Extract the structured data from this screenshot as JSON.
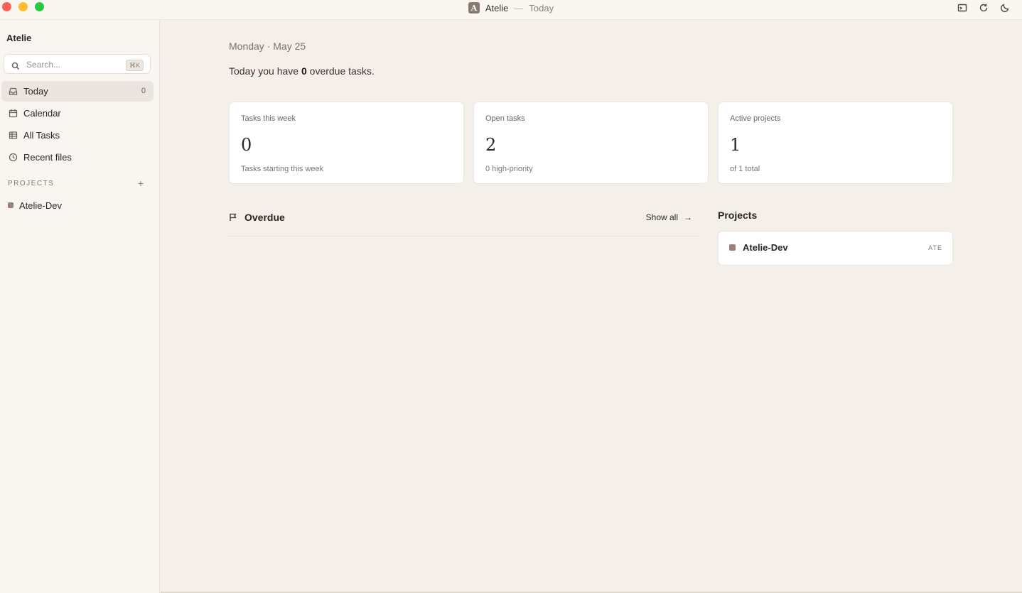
{
  "window": {
    "app_name": "Atelie",
    "separator": "—",
    "page": "Today",
    "app_badge_letter": "A",
    "actions": [
      "terminal-icon",
      "refresh-icon",
      "moon-icon"
    ]
  },
  "sidebar": {
    "workspace": "Atelie",
    "search": {
      "placeholder": "Search...",
      "shortcut": "⌘K"
    },
    "nav": [
      {
        "label": "Today",
        "icon": "inbox-icon",
        "count": "0",
        "active": true
      },
      {
        "label": "Calendar",
        "icon": "calendar-icon"
      },
      {
        "label": "All Tasks",
        "icon": "table-icon"
      },
      {
        "label": "Recent files",
        "icon": "clock-icon"
      }
    ],
    "projects_header": "PROJECTS",
    "add_label": "+",
    "projects": [
      {
        "label": "Atelie-Dev",
        "color": "#9b7f78"
      }
    ]
  },
  "main": {
    "date": "Monday · May 25",
    "summary": {
      "prefix": "Today you have",
      "count": "0",
      "suffix": "overdue tasks."
    },
    "cards": [
      {
        "label": "Tasks this week",
        "value": "0",
        "sub": "Tasks starting this week"
      },
      {
        "label": "Open tasks",
        "value": "2",
        "sub": "0 high-priority"
      },
      {
        "label": "Active projects",
        "value": "1",
        "sub": "of 1 total"
      }
    ],
    "overdue": {
      "title": "Overdue",
      "show_all": "Show all",
      "arrow": "→"
    },
    "projects": {
      "title": "Projects",
      "items": [
        {
          "name": "Atelie-Dev",
          "key": "ATE",
          "color": "#9b7f78"
        }
      ]
    }
  },
  "colors": {
    "accent": "#9b7f78",
    "background": "#f4efe8",
    "sidebar": "#f9f6f2"
  }
}
